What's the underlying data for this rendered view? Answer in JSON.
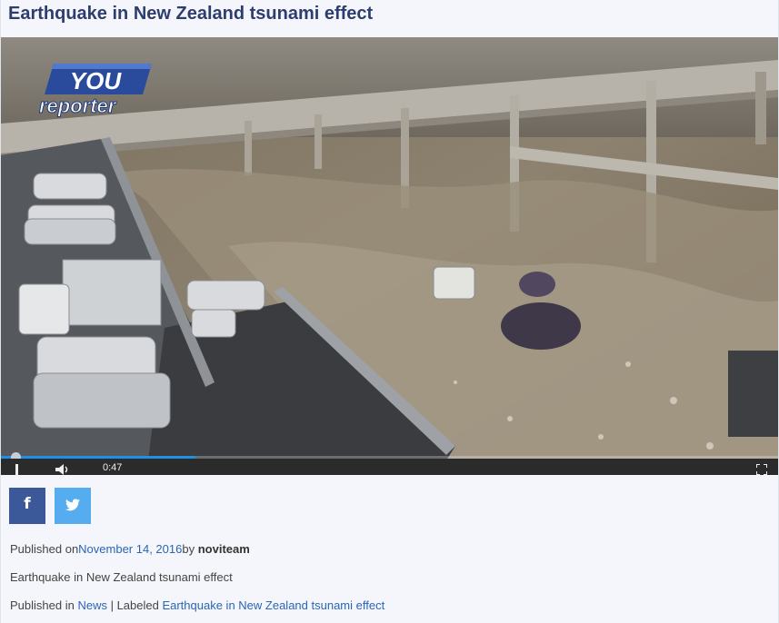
{
  "page": {
    "title": "Earthquake in New Zealand tsunami effect"
  },
  "video": {
    "logo_top": "YOU",
    "logo_bottom": "reporter",
    "time": "0:47",
    "progress_fraction": 0.25,
    "icons": [
      "pause-icon",
      "volume-icon",
      "fullscreen-icon"
    ]
  },
  "share": {
    "facebook_label": "f",
    "twitter_label": "t",
    "facebook_color": "#3b5998",
    "twitter_color": "#55acee"
  },
  "meta": {
    "published_prefix": "Published on",
    "date": "November 14, 2016",
    "by_label": "by",
    "author": "noviteam",
    "excerpt": "Earthquake in New Zealand tsunami effect",
    "published_in_label": "Published in",
    "category": "News",
    "separator": " | Labeled ",
    "tag": "Earthquake in New Zealand tsunami effect"
  },
  "colors": {
    "title": "#2d3e6e",
    "link": "#2b65b5",
    "progress": "#1e90e6"
  }
}
